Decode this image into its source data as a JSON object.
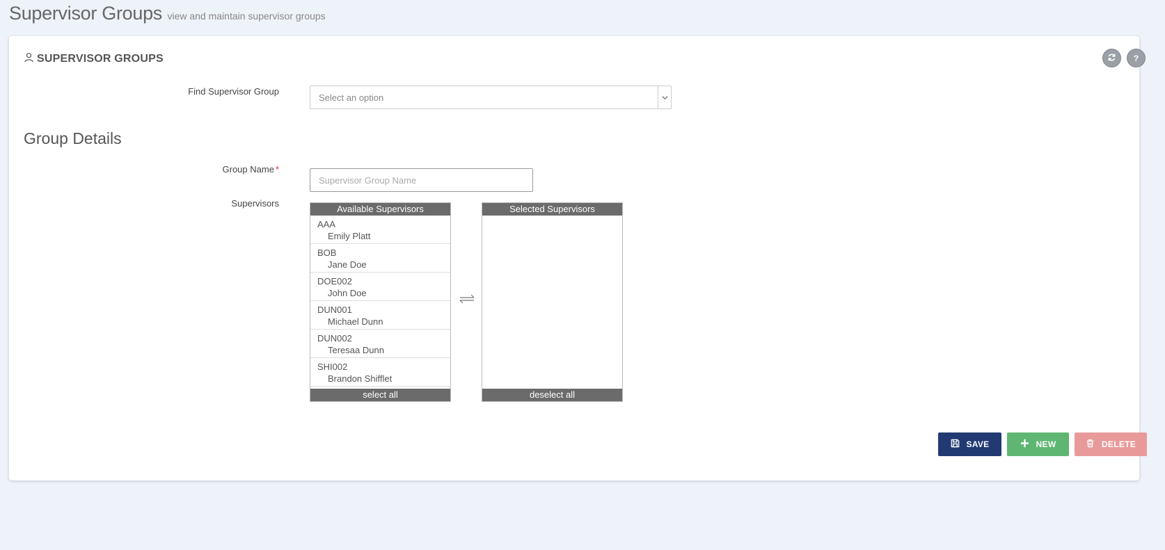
{
  "header": {
    "title": "Supervisor Groups",
    "subtitle": "view and maintain supervisor groups"
  },
  "card": {
    "title": "SUPERVISOR GROUPS",
    "help_label": "?"
  },
  "find": {
    "label": "Find Supervisor Group",
    "placeholder": "Select an option"
  },
  "details": {
    "section_title": "Group Details",
    "group_name_label": "Group Name",
    "required_mark": "*",
    "group_name_placeholder": "Supervisor Group Name",
    "supervisors_label": "Supervisors"
  },
  "available": {
    "header": "Available Supervisors",
    "footer": "select all",
    "items": [
      {
        "code": "AAA",
        "name": "Emily Platt"
      },
      {
        "code": "BOB",
        "name": "Jane Doe"
      },
      {
        "code": "DOE002",
        "name": "John Doe"
      },
      {
        "code": "DUN001",
        "name": "Michael Dunn"
      },
      {
        "code": "DUN002",
        "name": "Teresaa Dunn"
      },
      {
        "code": "SHI002",
        "name": "Brandon Shifflet"
      }
    ]
  },
  "selected": {
    "header": "Selected Supervisors",
    "footer": "deselect all",
    "items": []
  },
  "buttons": {
    "save": "SAVE",
    "new": "NEW",
    "delete": "DELETE"
  },
  "colors": {
    "save": "#213a72",
    "new": "#5fb672",
    "delete": "#e89a9a",
    "list_header": "#6b6b6b"
  },
  "icons": {
    "card_title": "user-icon",
    "refresh": "refresh-icon",
    "help": "help-icon",
    "dropdown": "chevron-down-icon",
    "transfer": "transfer-arrows-icon",
    "save": "floppy-disk-icon",
    "new": "plus-icon",
    "delete": "trash-icon"
  }
}
